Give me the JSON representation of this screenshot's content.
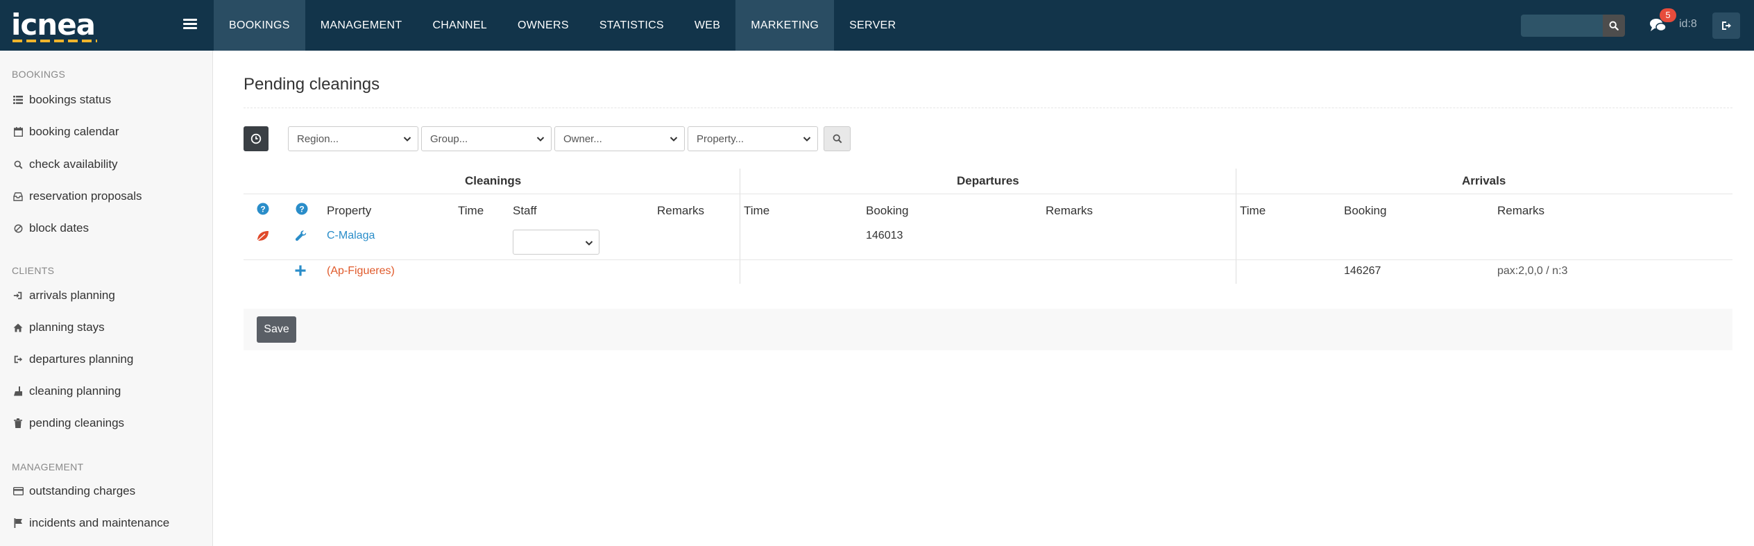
{
  "logo": {
    "text": "icnea"
  },
  "nav": {
    "items": [
      {
        "label": "BOOKINGS"
      },
      {
        "label": "MANAGEMENT"
      },
      {
        "label": "CHANNEL"
      },
      {
        "label": "OWNERS"
      },
      {
        "label": "STATISTICS"
      },
      {
        "label": "WEB"
      },
      {
        "label": "MARKETING"
      },
      {
        "label": "SERVER"
      }
    ],
    "active": [
      "BOOKINGS",
      "MARKETING"
    ]
  },
  "header": {
    "notification_count": "5",
    "user_id": "id:8",
    "search_placeholder": ""
  },
  "sidebar": {
    "sections": [
      {
        "title": "BOOKINGS"
      },
      {
        "title": "CLIENTS"
      },
      {
        "title": "MANAGEMENT"
      }
    ],
    "items": [
      {
        "label": "bookings status",
        "icon": "list-icon"
      },
      {
        "label": "booking calendar",
        "icon": "calendar-icon"
      },
      {
        "label": "check availability",
        "icon": "search-icon"
      },
      {
        "label": "reservation proposals",
        "icon": "inbox-icon"
      },
      {
        "label": "block dates",
        "icon": "ban-icon"
      },
      {
        "label": "arrivals planning",
        "icon": "sign-in-icon"
      },
      {
        "label": "planning stays",
        "icon": "home-icon"
      },
      {
        "label": "departures planning",
        "icon": "sign-out-icon"
      },
      {
        "label": "cleaning planning",
        "icon": "broom-icon"
      },
      {
        "label": "pending cleanings",
        "icon": "trash-icon"
      },
      {
        "label": "outstanding charges",
        "icon": "credit-card-icon"
      },
      {
        "label": "incidents and maintenance",
        "icon": "flag-icon"
      }
    ]
  },
  "main": {
    "title": "Pending cleanings",
    "filters": {
      "region": "Region...",
      "group": "Group...",
      "owner": "Owner...",
      "property": "Property..."
    },
    "groups": {
      "cleanings": "Cleanings",
      "departures": "Departures",
      "arrivals": "Arrivals"
    },
    "columns": {
      "property": "Property",
      "time": "Time",
      "staff": "Staff",
      "remarks": "Remarks",
      "dep_time": "Time",
      "dep_booking": "Booking",
      "dep_remarks": "Remarks",
      "arr_time": "Time",
      "arr_booking": "Booking",
      "arr_remarks": "Remarks"
    },
    "rows": [
      {
        "property": "C-Malaga",
        "dep_booking": "146013",
        "arr_booking": "",
        "arr_remarks": ""
      },
      {
        "property": "(Ap-Figueres)",
        "dep_booking": "",
        "arr_booking": "146267",
        "arr_remarks": "pax:2,0,0 / n:3"
      }
    ],
    "save_label": "Save"
  },
  "colors": {
    "topbar": "#12344a",
    "accent": "#2a8dc9",
    "warning": "#e05a2b",
    "badge": "#e74c3c"
  }
}
